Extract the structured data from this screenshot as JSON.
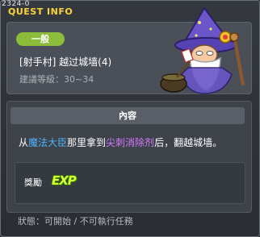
{
  "window": {
    "quest_id": "2324-0",
    "title": "QUEST INFO"
  },
  "quest": {
    "category_badge": "一般",
    "name": "[射手村] 越过城墙(4)",
    "level_label": "建議等級",
    "level_value": "30~34",
    "level_separator": "："
  },
  "content": {
    "header": "內容",
    "desc_pre": "从",
    "desc_npc": "魔法大臣",
    "desc_mid": "那里拿到",
    "desc_item": "尖刺消除剂",
    "desc_post": "后，翻越城墙。"
  },
  "reward": {
    "label": "獎勵",
    "exp_text": "EXP"
  },
  "status": {
    "text": "狀態：可開始 / 不可執行任務"
  },
  "colors": {
    "title": "#f2d04a",
    "badge": "#8bbd3a",
    "npc": "#4fb4ff",
    "item": "#d479ff",
    "exp": "#d9ff3a"
  },
  "icons": {
    "npc_portrait": "wizard-npc-portrait",
    "exp_icon": "exp-icon"
  }
}
